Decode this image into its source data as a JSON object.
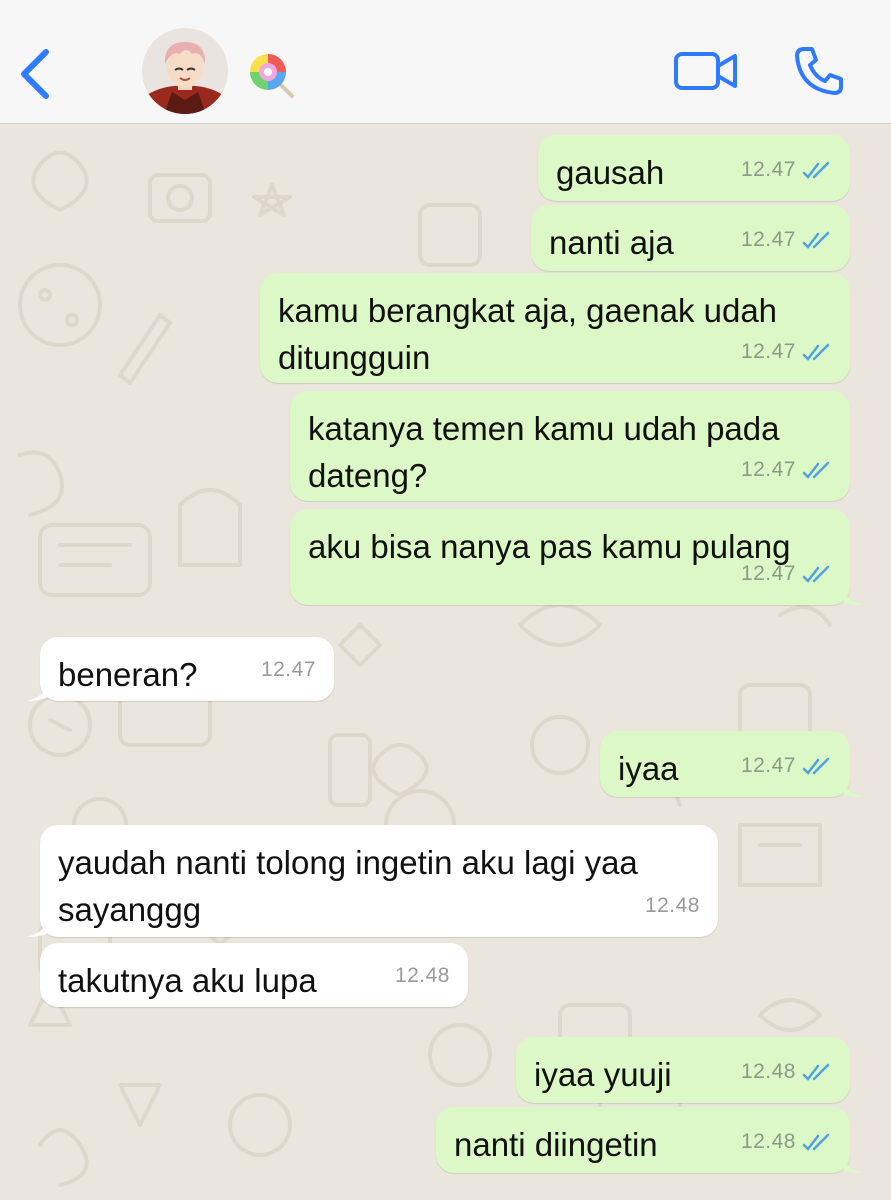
{
  "header": {
    "back_icon": "chevron-left-icon",
    "avatar_icon": "contact-avatar",
    "name_emoji": "lollipop-emoji",
    "video_icon": "video-camera-icon",
    "call_icon": "phone-icon",
    "accent_color": "#2f7bff"
  },
  "messages": [
    {
      "dir": "out",
      "text": "gausah",
      "time": "12.47",
      "read": true
    },
    {
      "dir": "out",
      "text": "nanti aja",
      "time": "12.47",
      "read": true
    },
    {
      "dir": "out",
      "text": "kamu berangkat aja, gaenak udah\nditungguin",
      "time": "12.47",
      "read": true
    },
    {
      "dir": "out",
      "text": "katanya temen kamu udah pada\ndateng?",
      "time": "12.47",
      "read": true
    },
    {
      "dir": "out",
      "text": "aku bisa nanya pas kamu pulang",
      "time": "12.47",
      "read": true
    },
    {
      "dir": "in",
      "text": "beneran?",
      "time": "12.47"
    },
    {
      "dir": "out",
      "text": "iyaa",
      "time": "12.47",
      "read": true
    },
    {
      "dir": "in",
      "text": "yaudah nanti tolong ingetin aku lagi yaa\nsayanggg",
      "time": "12.48"
    },
    {
      "dir": "in",
      "text": "takutnya aku lupa",
      "time": "12.48"
    },
    {
      "dir": "out",
      "text": "iyaa yuuji",
      "time": "12.48",
      "read": true
    },
    {
      "dir": "out",
      "text": "nanti diingetin",
      "time": "12.48",
      "read": true
    }
  ],
  "colors": {
    "outgoing_bubble": "#dcf8c6",
    "incoming_bubble": "#ffffff",
    "read_ticks": "#4fa3e0",
    "wallpaper": "#ebe6dd"
  }
}
